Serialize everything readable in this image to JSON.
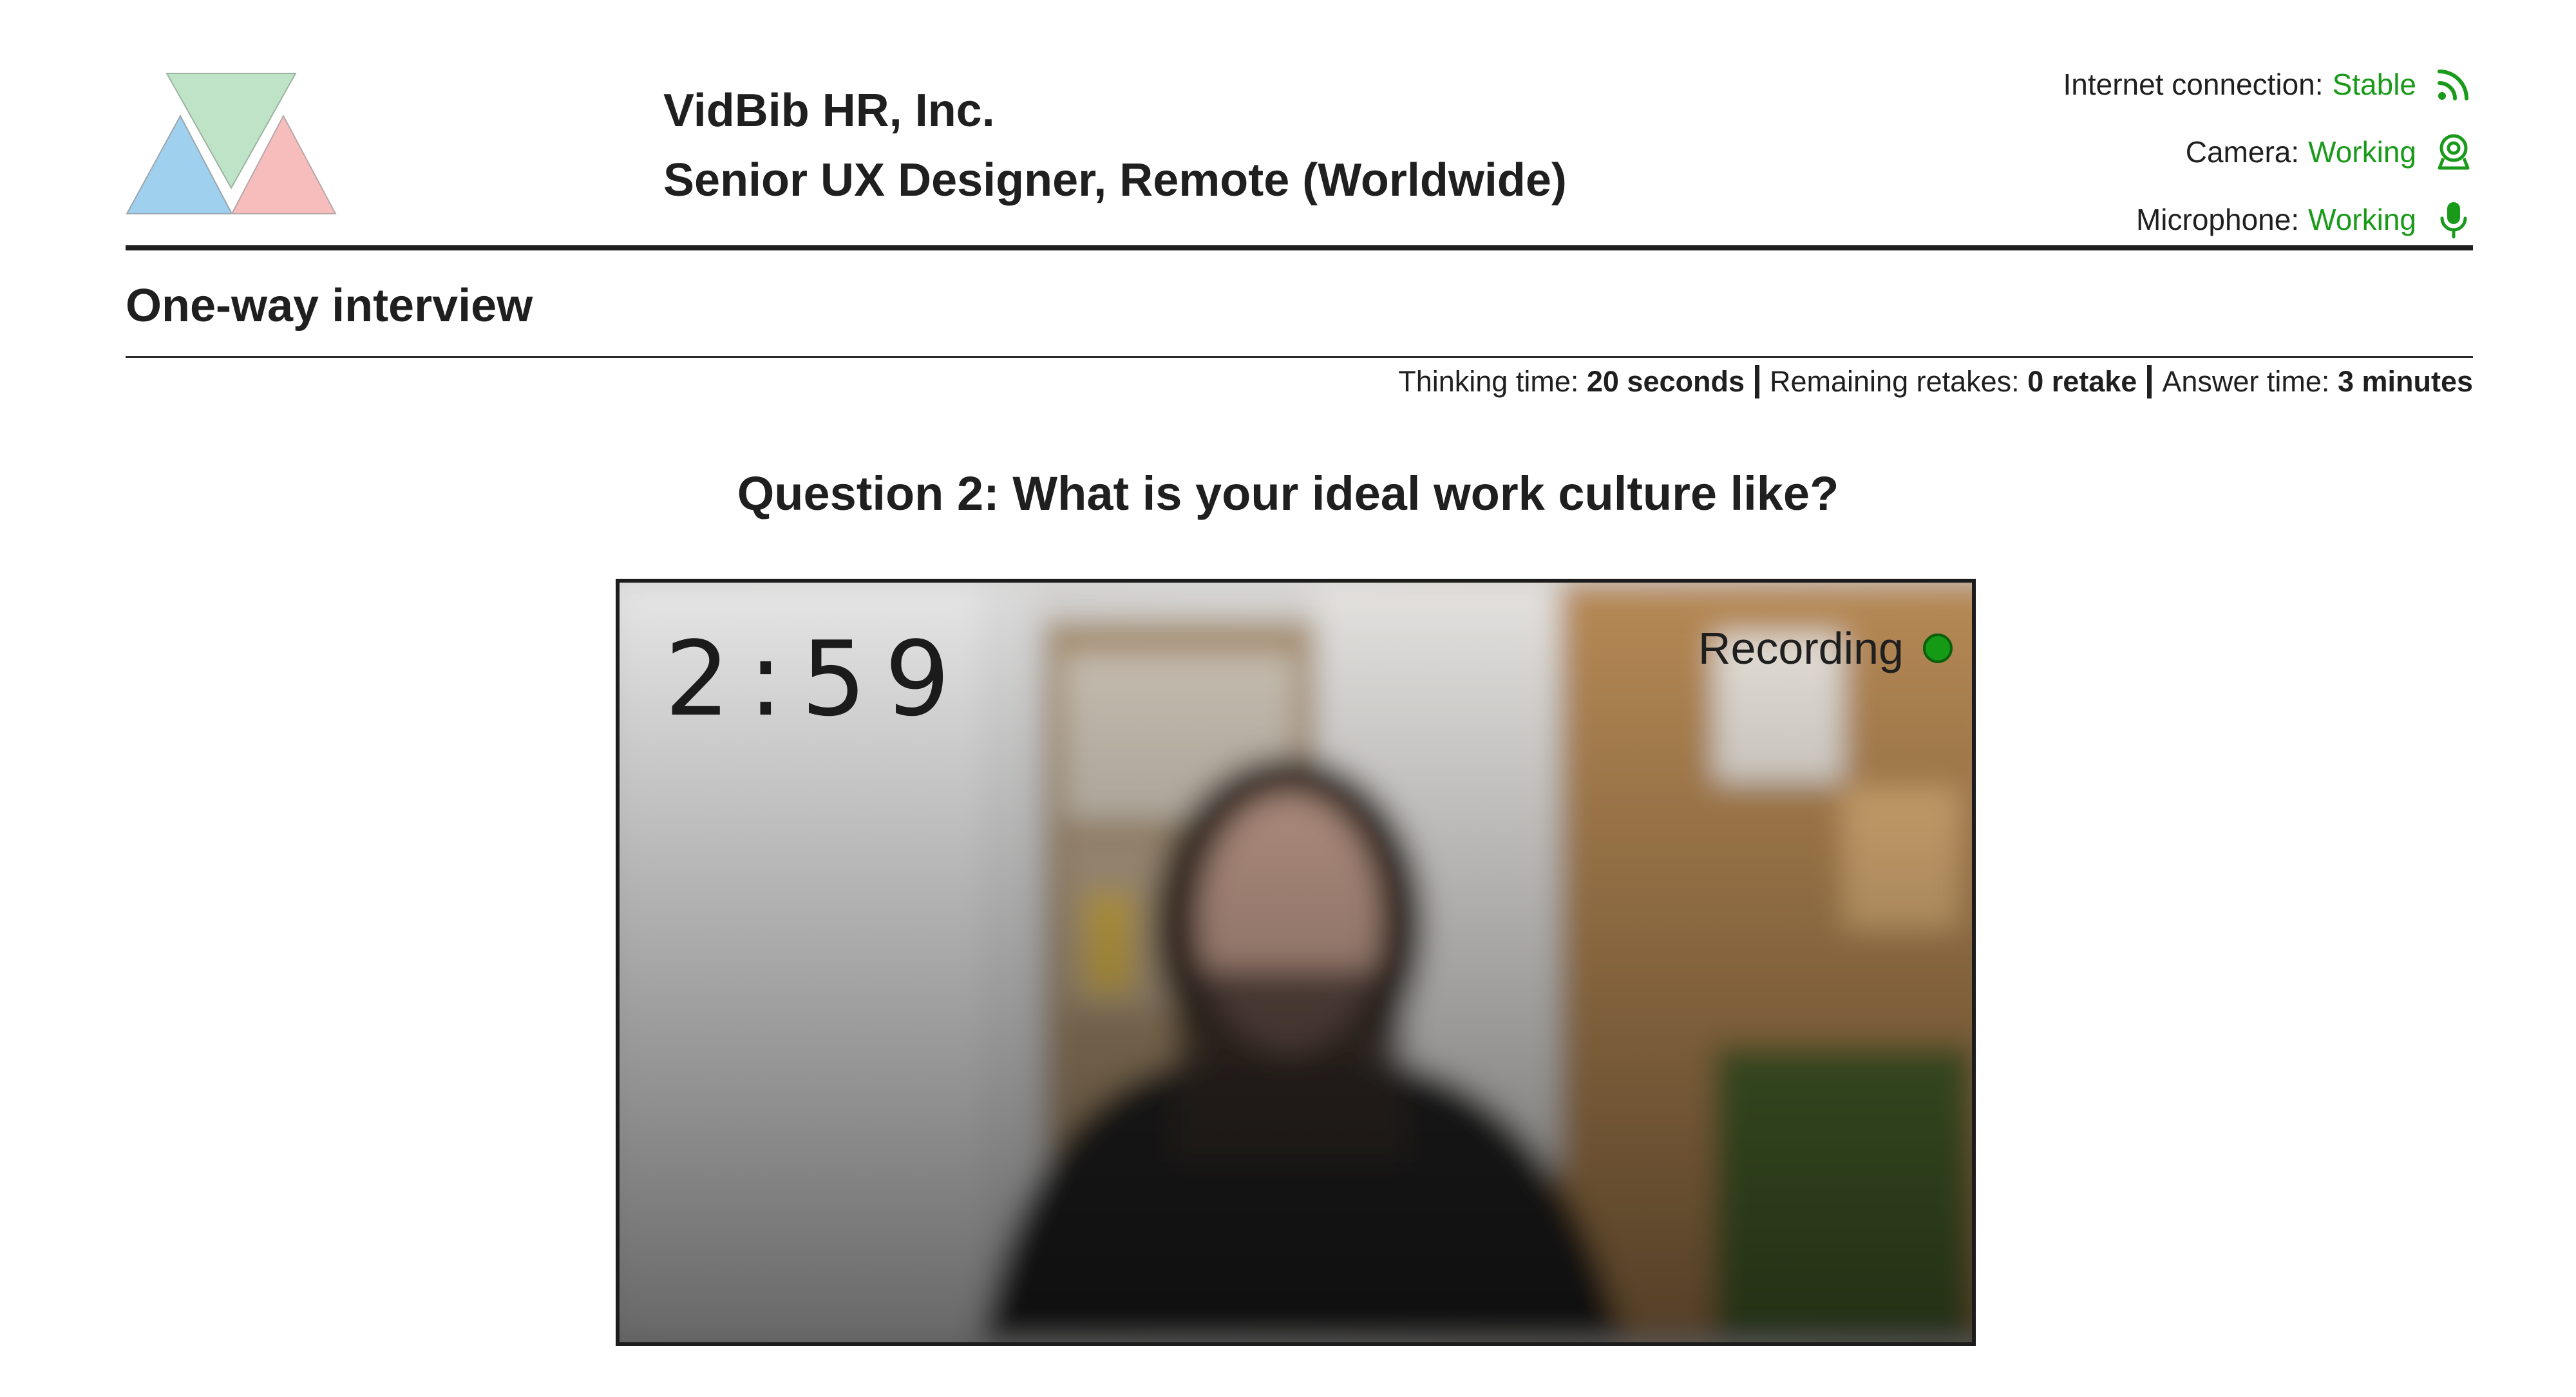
{
  "company": {
    "name": "VidBib HR, Inc.",
    "job_title": "Senior UX Designer, Remote (Worldwide)"
  },
  "status": {
    "internet": {
      "label": "Internet connection:",
      "value": "Stable",
      "icon": "wifi-signal-icon"
    },
    "camera": {
      "label": "Camera:",
      "value": "Working",
      "icon": "webcam-icon"
    },
    "microphone": {
      "label": "Microphone:",
      "value": "Working",
      "icon": "microphone-icon"
    }
  },
  "section_title": "One-way interview",
  "meta": {
    "thinking_label": "Thinking time:",
    "thinking_value": "20 seconds",
    "retakes_label": "Remaining retakes:",
    "retakes_value": "0 retake",
    "answer_label": "Answer time:",
    "answer_value": "3 minutes"
  },
  "question": "Question 2: What is your ideal work culture like?",
  "video": {
    "timer": "2:59",
    "recording_label": "Recording",
    "recording_indicator_color": "#159a15"
  },
  "colors": {
    "status_ok": "#1a9a1a",
    "logo_green": "#bfe3c6",
    "logo_blue": "#9fd0ee",
    "logo_pink": "#f7bcbc"
  }
}
